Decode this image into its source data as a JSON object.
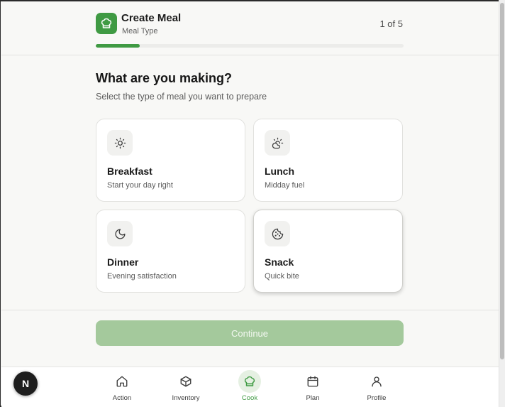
{
  "header": {
    "title": "Create Meal",
    "subtitle": "Meal Type",
    "step_count": "1 of 5",
    "progress": 0.143
  },
  "main": {
    "heading": "What are you making?",
    "subheading": "Select the type of meal you want to prepare",
    "options": [
      {
        "title": "Breakfast",
        "description": "Start your day right",
        "icon": "sun-icon",
        "selected": false
      },
      {
        "title": "Lunch",
        "description": "Midday fuel",
        "icon": "cloud-sun-icon",
        "selected": false
      },
      {
        "title": "Dinner",
        "description": "Evening satisfaction",
        "icon": "moon-icon",
        "selected": false
      },
      {
        "title": "Snack",
        "description": "Quick bite",
        "icon": "cookie-icon",
        "selected": true
      }
    ],
    "continue_label": "Continue"
  },
  "nav": {
    "items": [
      {
        "label": "Action",
        "icon": "home-icon",
        "active": false
      },
      {
        "label": "Inventory",
        "icon": "box-icon",
        "active": false
      },
      {
        "label": "Cook",
        "icon": "chef-hat-icon",
        "active": true
      },
      {
        "label": "Plan",
        "icon": "calendar-icon",
        "active": false
      },
      {
        "label": "Profile",
        "icon": "user-icon",
        "active": false
      }
    ]
  },
  "badge": {
    "letter": "N"
  },
  "colors": {
    "accent": "#3f9a43",
    "button_disabled": "#a4c99c",
    "active_nav_bg": "#e5f0e2"
  }
}
